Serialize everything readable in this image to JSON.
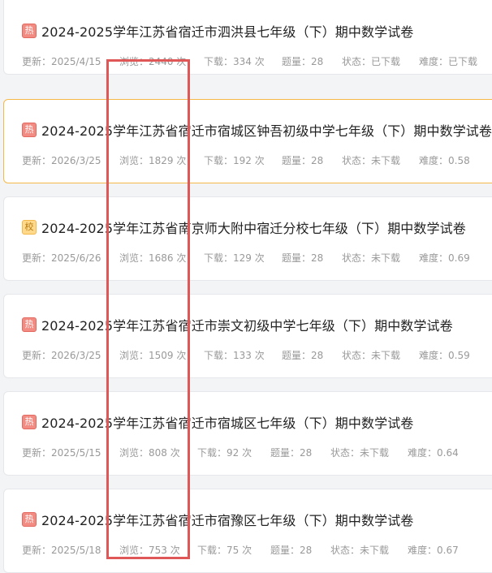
{
  "cards": [
    {
      "tag": "热",
      "tag_type": "hot",
      "title": "2024-2025学年江苏省宿迁市泗洪县七年级（下）期中数学试卷",
      "updated": "更新：2025/4/15",
      "views": "浏览：2440 次",
      "downloads": "下载：334 次",
      "questions": "题量：28",
      "status": "状态：已下载",
      "difficulty": "难度：已下载"
    },
    {
      "tag": "热",
      "tag_type": "hot",
      "title": "2024-2025学年江苏省宿迁市宿城区钟吾初级中学七年级（下）期中数学试卷",
      "updated": "更新：2026/3/25",
      "views": "浏览：1829 次",
      "downloads": "下载：192 次",
      "questions": "题量：28",
      "status": "状态：未下载",
      "difficulty": "难度：0.58"
    },
    {
      "tag": "校",
      "tag_type": "school",
      "title": "2024-2025学年江苏省南京师大附中宿迁分校七年级（下）期中数学试卷",
      "updated": "更新：2025/6/26",
      "views": "浏览：1686 次",
      "downloads": "下载：129 次",
      "questions": "题量：28",
      "status": "状态：未下载",
      "difficulty": "难度：0.69"
    },
    {
      "tag": "热",
      "tag_type": "hot",
      "title": "2024-2025学年江苏省宿迁市崇文初级中学七年级（下）期中数学试卷",
      "updated": "更新：2026/3/25",
      "views": "浏览：1509 次",
      "downloads": "下载：133 次",
      "questions": "题量：28",
      "status": "状态：未下载",
      "difficulty": "难度：0.59"
    },
    {
      "tag": "热",
      "tag_type": "hot",
      "title": "2024-2025学年江苏省宿迁市宿城区七年级（下）期中数学试卷",
      "updated": "更新：2025/5/15",
      "views": "浏览：808 次",
      "downloads": "下载：92 次",
      "questions": "题量：28",
      "status": "状态：未下载",
      "difficulty": "难度：0.64"
    },
    {
      "tag": "热",
      "tag_type": "hot",
      "title": "2024-2025学年江苏省宿迁市宿豫区七年级（下）期中数学试卷",
      "updated": "更新：2025/5/18",
      "views": "浏览：753 次",
      "downloads": "下载：75 次",
      "questions": "题量：28",
      "status": "状态：未下载",
      "difficulty": "难度：0.67"
    }
  ],
  "colors": {
    "highlight": "#e05757",
    "active_border": "#f5b94a",
    "hot_tag": "#f28b82",
    "school_tag": "#ffd98a"
  }
}
